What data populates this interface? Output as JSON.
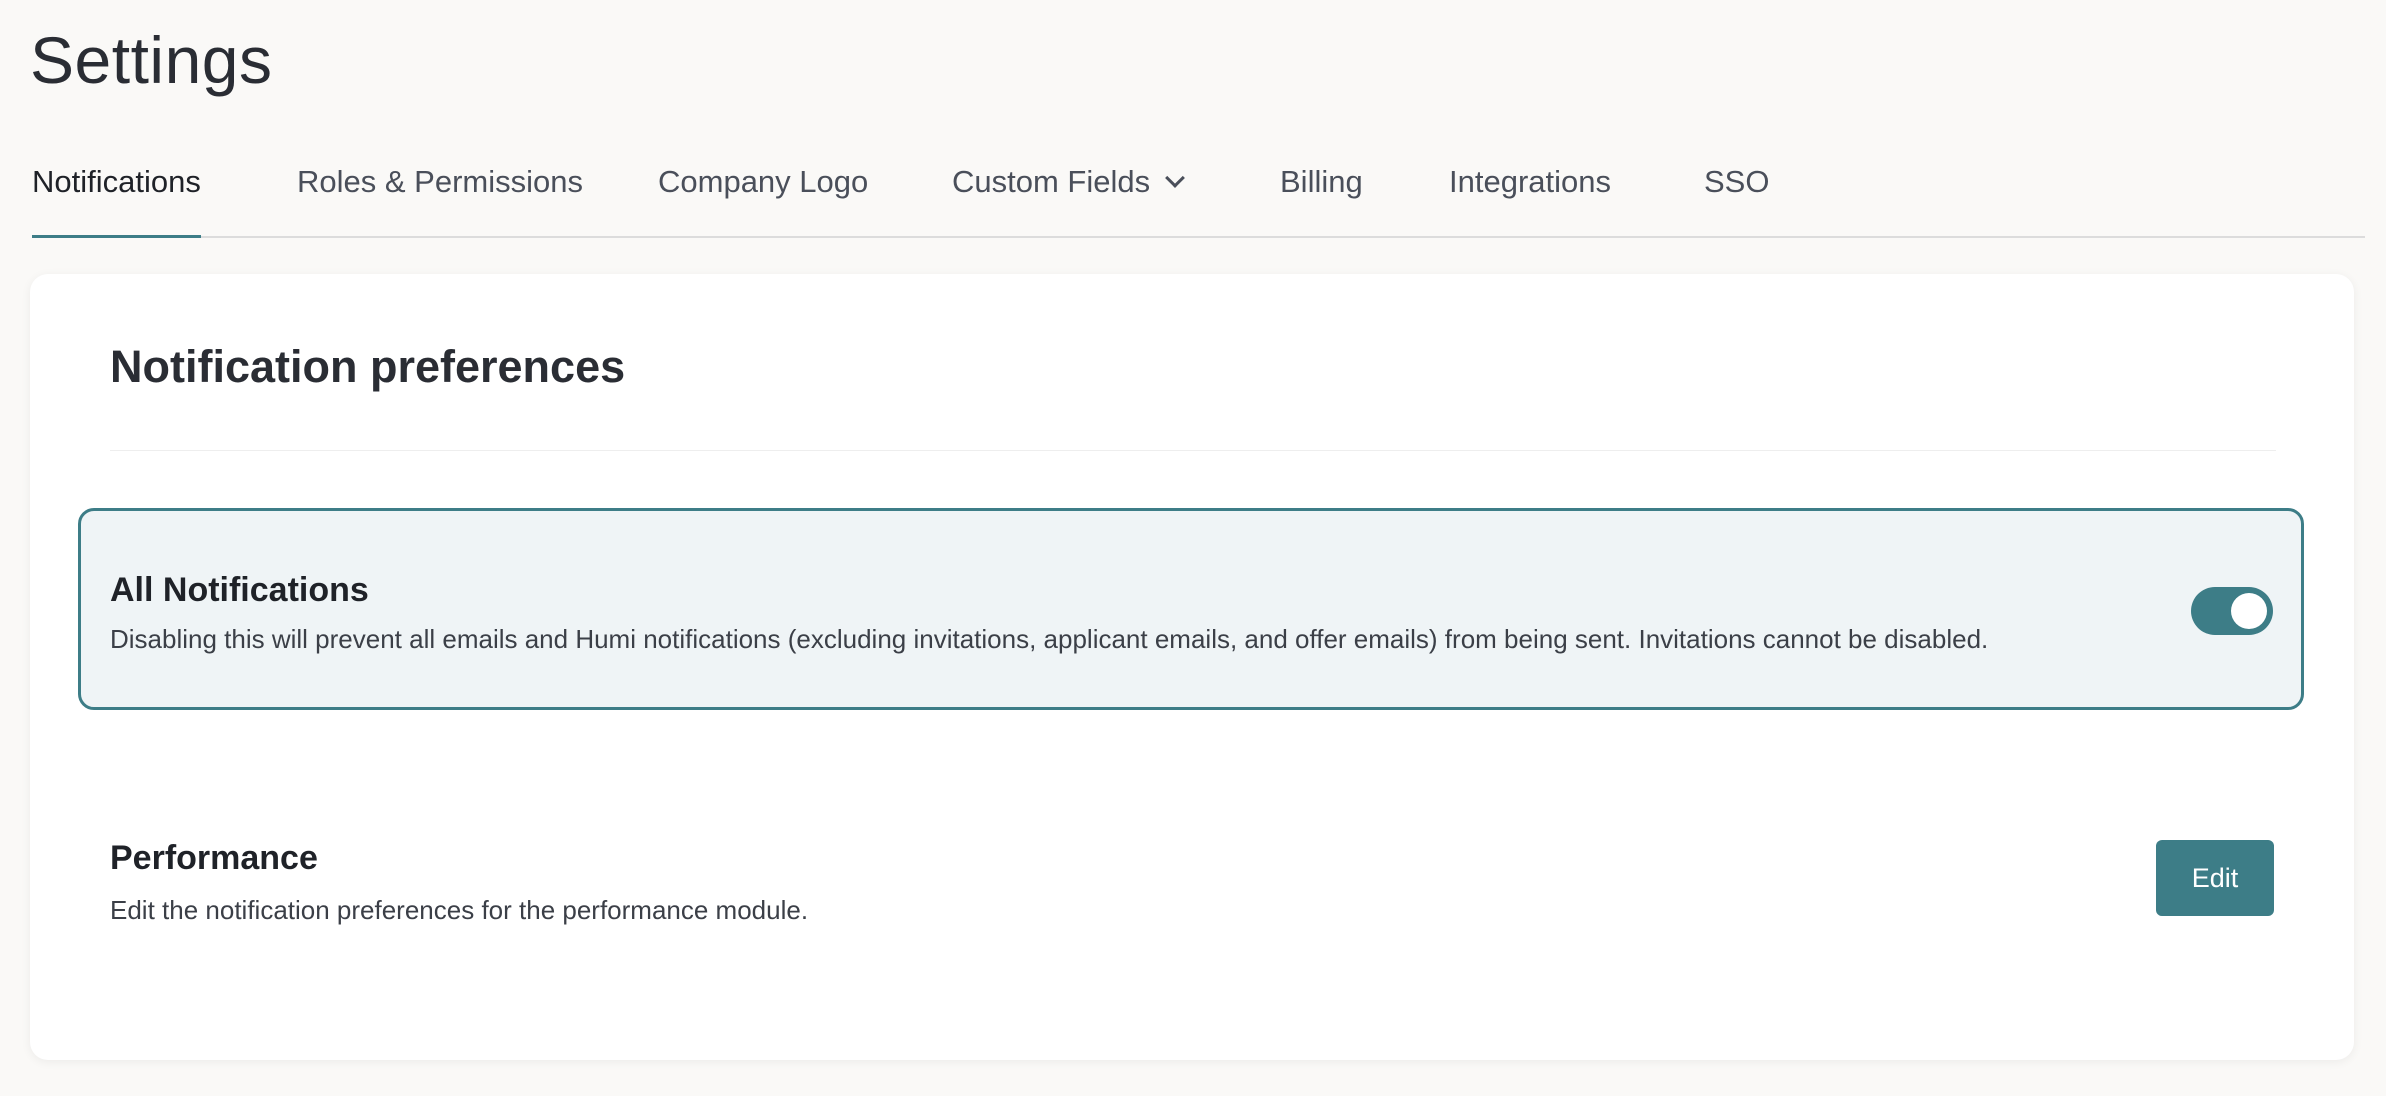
{
  "page": {
    "title": "Settings"
  },
  "tabs": [
    {
      "label": "Notifications",
      "active": true
    },
    {
      "label": "Roles & Permissions",
      "active": false
    },
    {
      "label": "Company Logo",
      "active": false
    },
    {
      "label": "Custom Fields",
      "active": false,
      "has_dropdown": true,
      "icon": "chevron-down-icon"
    },
    {
      "label": "Billing",
      "active": false
    },
    {
      "label": "Integrations",
      "active": false
    },
    {
      "label": "SSO",
      "active": false
    }
  ],
  "card": {
    "title": "Notification preferences",
    "all_notifications": {
      "title": "All Notifications",
      "description": "Disabling this will prevent all emails and Humi notifications (excluding invitations, applicant emails, and offer emails) from being sent. Invitations cannot be disabled.",
      "toggle_on": true
    },
    "performance": {
      "title": "Performance",
      "description": "Edit the notification preferences for the performance module.",
      "button_label": "Edit"
    }
  },
  "colors": {
    "accent": "#3d7d87",
    "highlight_bg": "#eff4f6",
    "page_bg": "#faf9f7"
  }
}
